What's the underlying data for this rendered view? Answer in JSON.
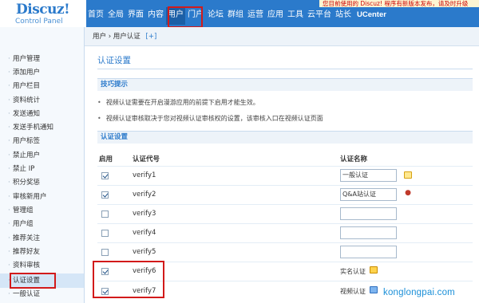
{
  "header": {
    "brand": "Discuz!",
    "subtitle": "Control Panel",
    "notice": "您目前使用的 Discuz! 程序有新版本发布，请及时升级",
    "nav": [
      "首页",
      "全局",
      "界面",
      "内容",
      "用户",
      "门户",
      "论坛",
      "群组",
      "运营",
      "应用",
      "工具",
      "云平台",
      "站长",
      "UCenter"
    ],
    "active_nav": "用户"
  },
  "sidebar": {
    "items": [
      "用户管理",
      "添加用户",
      "用户栏目",
      "资料统计",
      "发送通知",
      "发送手机通知",
      "用户标签",
      "禁止用户",
      "禁止 IP",
      "积分奖惩",
      "审核新用户",
      "管理组",
      "用户组",
      "推荐关注",
      "推荐好友",
      "资料审核",
      "认证设置",
      "一般认证"
    ],
    "active": "认证设置"
  },
  "main": {
    "breadcrumb": "用户 › 用户认证",
    "add_label": "[+]",
    "title": "认证设置",
    "tips_heading": "技巧提示",
    "tips": [
      "视频认证需要在开启漫游应用的前提下启用才能生效。",
      "视频认证审核取决于您对视频认证审核权的设置，该审核入口在视频认证页面"
    ],
    "settings_heading": "认证设置",
    "columns": {
      "enabled": "启用",
      "code": "认证代号",
      "name": "认证名称"
    },
    "rows": [
      {
        "code": "verify1",
        "checked": true,
        "name": "一般认证",
        "name_type": "input",
        "icon": "card-icon"
      },
      {
        "code": "verify2",
        "checked": true,
        "name": "Q&A站认证",
        "name_type": "input",
        "icon": "qq-penguin-icon"
      },
      {
        "code": "verify3",
        "checked": false,
        "name": "",
        "name_type": "input",
        "icon": ""
      },
      {
        "code": "verify4",
        "checked": false,
        "name": "",
        "name_type": "input",
        "icon": ""
      },
      {
        "code": "verify5",
        "checked": false,
        "name": "",
        "name_type": "input",
        "icon": ""
      },
      {
        "code": "verify6",
        "checked": true,
        "name": "实名认证",
        "name_type": "text",
        "icon": "realname-badge-icon"
      },
      {
        "code": "verify7",
        "checked": true,
        "name": "视频认证",
        "name_type": "text",
        "icon": "video-badge-icon"
      }
    ]
  },
  "watermark": "konglongpai.com",
  "colors": {
    "header_bg": "#2b7acb",
    "highlight_border": "#d21a1a",
    "section_text": "#2b7acb"
  }
}
